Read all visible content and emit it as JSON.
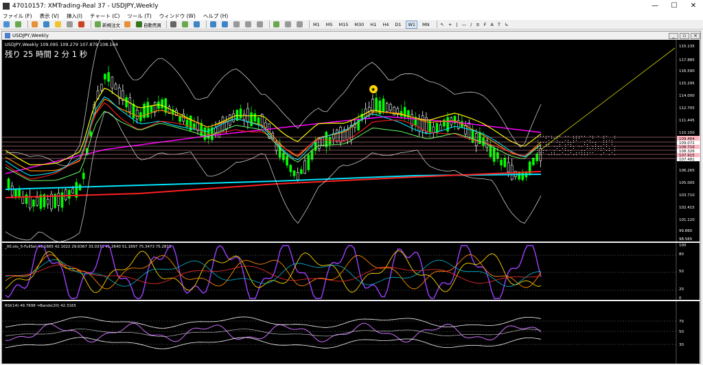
{
  "window": {
    "title": "47010157: XMTrading-Real 37 - USDJPY,Weekly",
    "min": "—",
    "max": "☐",
    "close": "✕"
  },
  "menu": [
    "ファイル (F)",
    "表示 (V)",
    "挿入(I)",
    "チャート (C)",
    "ツール (T)",
    "ウィンドウ (W)",
    "ヘルプ (H)"
  ],
  "toolbar": {
    "new_order": "新規注文",
    "auto_trade": "自動売買",
    "timeframes": [
      "M1",
      "M5",
      "M15",
      "M30",
      "H1",
      "H4",
      "D1",
      "W1",
      "MN"
    ]
  },
  "chart_window": {
    "title": "USDJPY,Weekly"
  },
  "main_panel": {
    "symbol_line": "USDJPY,Weekly  109.095 109.279 107.879 108.164",
    "countdown": "残り 25 時間 2 分 1 秒",
    "price_labels": [
      "115.135",
      "117.885",
      "116.590",
      "115.295",
      "114.000",
      "112.705",
      "111.445",
      "110.150",
      "109.464",
      "109.072",
      "108.716",
      "108.326",
      "107.915",
      "107.481",
      "106.265",
      "105.005",
      "103.710",
      "102.415",
      "101.120",
      "99.860",
      "98.565"
    ]
  },
  "osc_panel": {
    "label": "_00.sto_5-FullSet 46.1665 42.1022 29.6367 33.0373 41.2640 51.1897 75.3473 75.2818",
    "levels": [
      "100",
      "80",
      "50",
      "20",
      "0"
    ]
  },
  "rsi_panel": {
    "label": "RSI(14) 49.7698  ⇒Bands(20) 42.3165",
    "levels": [
      "70",
      "50",
      "30"
    ]
  },
  "colors": {
    "background": "#000000",
    "up": "#00ff00",
    "ma_magenta": "#ff00ff",
    "ma_red": "#ff2020",
    "ma_cyan": "#00e5ff",
    "ma_yellow": "#ffff00",
    "ma_orange": "#ff8c00"
  }
}
